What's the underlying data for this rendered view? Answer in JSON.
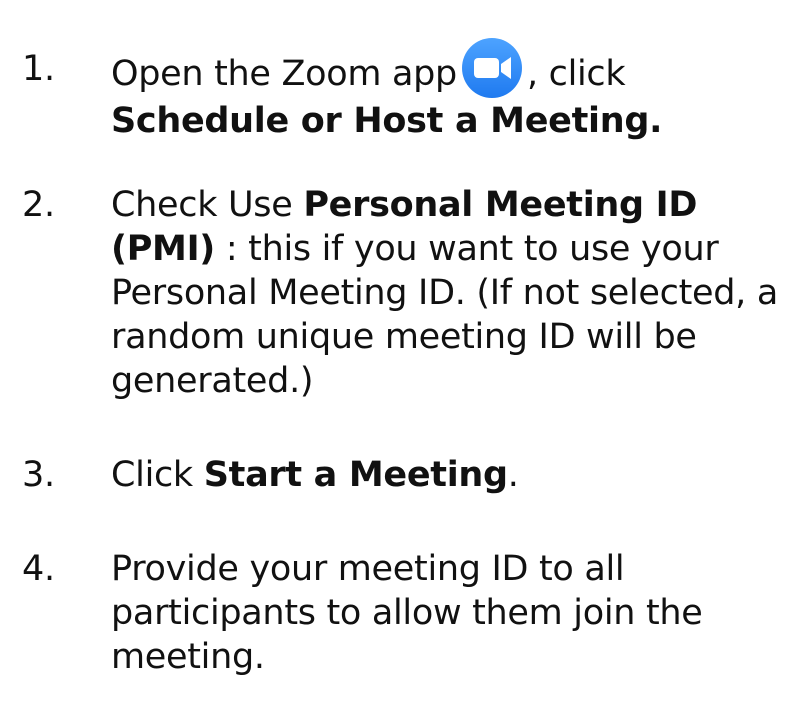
{
  "steps": [
    {
      "number": "1.",
      "text_a": "Open the Zoom app",
      "icon": "zoom-app-icon",
      "text_b": ", click",
      "bold_a": "Schedule or Host a Meeting."
    },
    {
      "number": "2.",
      "text_a": "Check Use",
      "bold_a": "Personal Meeting ID (PMI)",
      "text_b": " : this if you want to use your Personal Meeting ID. (If not selected, a random unique meeting ID will be generated.)"
    },
    {
      "number": "3.",
      "text_a": "Click",
      "bold_a": "Start a Meeting",
      "text_b": "."
    },
    {
      "number": "4.",
      "text_a": "Provide your meeting ID to all participants to allow them join the meeting."
    }
  ],
  "colors": {
    "zoom_blue": "#2D8CFF",
    "text": "#111111"
  }
}
